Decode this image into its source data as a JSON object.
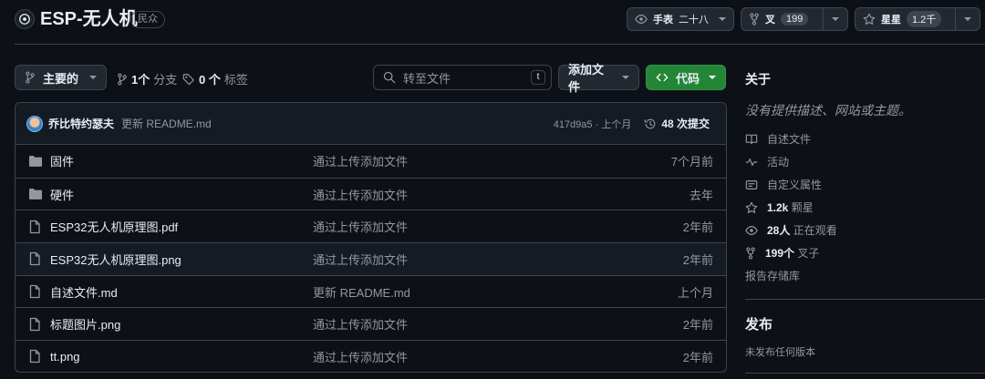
{
  "repo": {
    "name": "ESP-无人机",
    "visibility": "民众"
  },
  "header_actions": {
    "watch": {
      "label": "手表",
      "count": "二十八"
    },
    "fork": {
      "label": "叉",
      "count": "199"
    },
    "star": {
      "label": "星星",
      "count": "1.2千"
    }
  },
  "toolbar": {
    "branch_label": "主要的",
    "branches_count": "1个",
    "branches_label": "分支",
    "tags_count": "0 个",
    "tags_label": "标签",
    "search_placeholder": "转至文件",
    "search_shortcut": "t",
    "add_file_label": "添加文件",
    "code_label": "代码"
  },
  "commit": {
    "author": "乔比特约瑟夫",
    "message": "更新 README.md",
    "hash_time": "417d9a5 · 上个月",
    "commits_count": "48 次提交"
  },
  "files": [
    {
      "type": "dir",
      "name": "固件",
      "message": "通过上传添加文件",
      "date": "7个月前"
    },
    {
      "type": "dir",
      "name": "硬件",
      "message": "通过上传添加文件",
      "date": "去年"
    },
    {
      "type": "file",
      "name": "ESP32无人机原理图.pdf",
      "message": "通过上传添加文件",
      "date": "2年前"
    },
    {
      "type": "file",
      "name": "ESP32无人机原理图.png",
      "message": "通过上传添加文件",
      "date": "2年前"
    },
    {
      "type": "file",
      "name": "自述文件.md",
      "message": "更新 README.md",
      "date": "上个月"
    },
    {
      "type": "file",
      "name": "标题图片.png",
      "message": "通过上传添加文件",
      "date": "2年前"
    },
    {
      "type": "file",
      "name": "tt.png",
      "message": "通过上传添加文件",
      "date": "2年前"
    }
  ],
  "about": {
    "heading": "关于",
    "description": "没有提供描述、网站或主题。",
    "readme": "自述文件",
    "activity": "活动",
    "custom_properties": "自定义属性",
    "stars_count": "1.2k",
    "stars_label": "颗星",
    "watchers_count": "28人",
    "watchers_label": "正在观看",
    "forks_count": "199个",
    "forks_label": "叉子",
    "report": "报告存储库"
  },
  "releases": {
    "heading": "发布",
    "none": "未发布任何版本"
  },
  "colors": {
    "background": "#0d1117",
    "border": "#3d444d",
    "code_button": "#238636",
    "muted_text": "#9198a1"
  }
}
